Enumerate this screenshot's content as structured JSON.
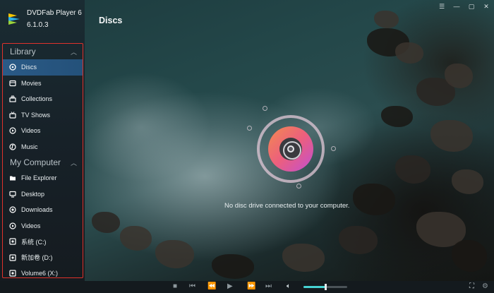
{
  "app": {
    "name": "DVDFab Player 6",
    "version": "6.1.0.3"
  },
  "header": {
    "title": "Discs"
  },
  "sidebar": {
    "library": {
      "title": "Library",
      "items": [
        {
          "label": "Discs",
          "icon": "disc-icon",
          "active": true
        },
        {
          "label": "Movies",
          "icon": "movie-icon"
        },
        {
          "label": "Collections",
          "icon": "collections-icon"
        },
        {
          "label": "TV Shows",
          "icon": "tv-icon"
        },
        {
          "label": "Videos",
          "icon": "video-icon"
        },
        {
          "label": "Music",
          "icon": "music-icon"
        }
      ]
    },
    "my_computer": {
      "title": "My Computer",
      "items": [
        {
          "label": "File Explorer",
          "icon": "file-explorer-icon"
        },
        {
          "label": "Desktop",
          "icon": "desktop-icon"
        },
        {
          "label": "Downloads",
          "icon": "download-icon"
        },
        {
          "label": "Videos",
          "icon": "video-icon"
        },
        {
          "label": "系统 (C:)",
          "icon": "drive-icon"
        },
        {
          "label": "新加卷 (D:)",
          "icon": "drive-icon"
        },
        {
          "label": "Volume6 (X:)",
          "icon": "drive-icon"
        }
      ]
    }
  },
  "main": {
    "message": "No disc drive connected to your computer."
  },
  "player": {
    "volume_level": 0.5
  },
  "colors": {
    "accent": "#2a5a86",
    "highlight_border": "#e0322b",
    "volume": "#46d2d2"
  }
}
